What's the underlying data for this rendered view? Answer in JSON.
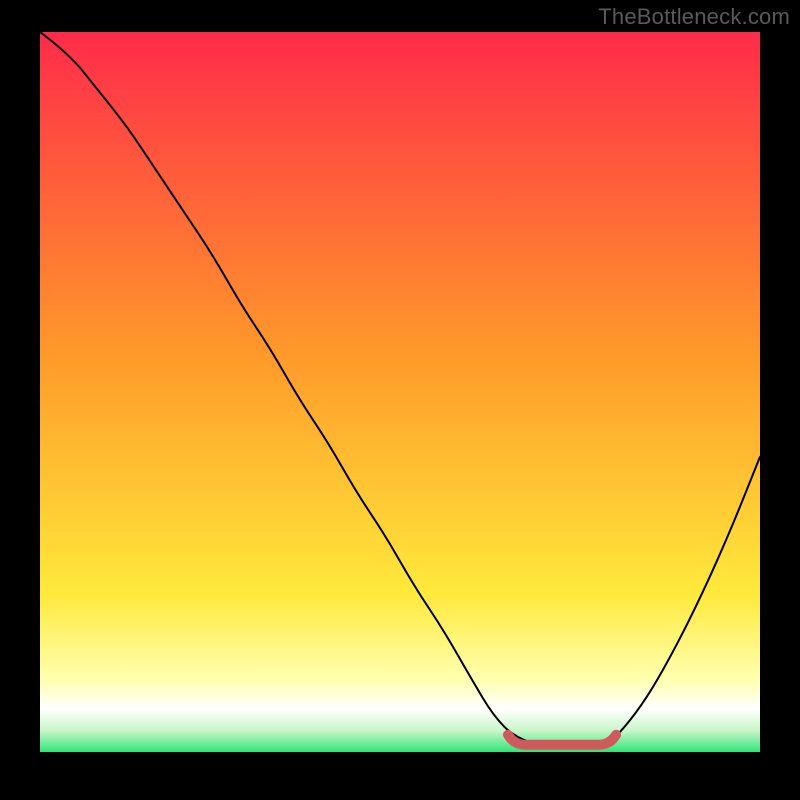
{
  "watermark": "TheBottleneck.com",
  "chart_data": {
    "type": "line",
    "title": "",
    "xlabel": "",
    "ylabel": "",
    "xlim": [
      0,
      100
    ],
    "ylim": [
      0,
      100
    ],
    "grid": false,
    "background_gradient": {
      "top_color": "#ff2b4a",
      "mid_color": "#ffd500",
      "bottom_white_band": "#ffffff",
      "bottom_green_band": "#2fe47a"
    },
    "series": [
      {
        "name": "bottleneck-curve",
        "x": [
          0,
          4,
          8,
          12,
          16,
          20,
          24,
          28,
          32,
          36,
          40,
          44,
          48,
          52,
          56,
          60,
          63,
          66,
          70,
          74,
          78,
          80,
          84,
          88,
          92,
          96,
          100
        ],
        "y": [
          100,
          97,
          92,
          87,
          81,
          75,
          69,
          62,
          56,
          49,
          43,
          36,
          30,
          23,
          17,
          10,
          5,
          2,
          0.8,
          0.5,
          0.8,
          2,
          7,
          14,
          22,
          31,
          41
        ]
      }
    ],
    "optimal_range": {
      "x_start": 65,
      "x_end": 80,
      "y": 1
    }
  }
}
